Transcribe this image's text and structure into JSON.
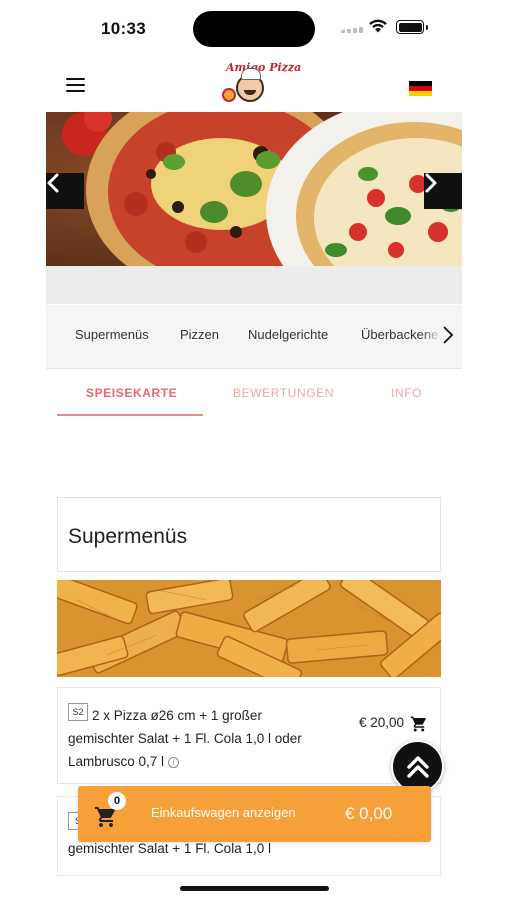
{
  "status_bar": {
    "time": "10:33"
  },
  "header": {
    "logo_text": "Amigo Pizza",
    "language_flag": "germany-flag-icon"
  },
  "categories": [
    "Supermenüs",
    "Pizzen",
    "Nudelgerichte",
    "Überbackene"
  ],
  "tabs": [
    {
      "label": "SPEISEKARTE",
      "active": true
    },
    {
      "label": "BEWERTUNGEN",
      "active": false
    },
    {
      "label": "INFO",
      "active": false
    }
  ],
  "section": {
    "title": "Supermenüs"
  },
  "items": [
    {
      "code": "S2",
      "text": "2 x Pizza ø26 cm + 1 großer gemischter Salat + 1 Fl. Cola 1,0 l oder Lambrusco 0,7 l",
      "price": "€ 20,00"
    },
    {
      "code": "S",
      "text": "gemischter Salat + 1 Fl. Cola 1,0 l"
    }
  ],
  "cart": {
    "count": "0",
    "label": "Einkaufswagen anzeigen",
    "total": "€ 0,00"
  },
  "colors": {
    "accent_tab": "#e36b6b",
    "cart_bar": "#f7a03a",
    "nav_bg": "#f5f5f5"
  }
}
